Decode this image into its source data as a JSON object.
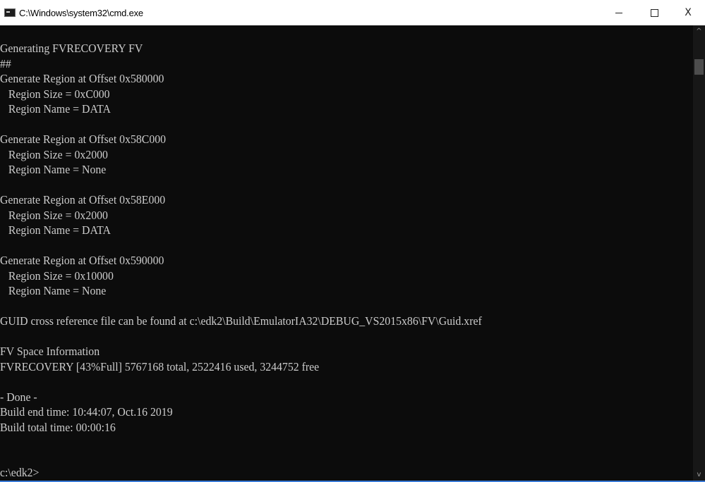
{
  "window": {
    "title": "C:\\Windows\\system32\\cmd.exe",
    "icon": "cmd-console-icon",
    "controls": {
      "minimize_glyph": "minimize-icon",
      "maximize_glyph": "maximize-icon",
      "close_label": "X"
    }
  },
  "console": {
    "text_color": "#cccccc",
    "background_color": "#0c0c0c",
    "lines": [
      "Generating FVRECOVERY FV",
      "##",
      "Generate Region at Offset 0x580000",
      "   Region Size = 0xC000",
      "   Region Name = DATA",
      "",
      "Generate Region at Offset 0x58C000",
      "   Region Size = 0x2000",
      "   Region Name = None",
      "",
      "Generate Region at Offset 0x58E000",
      "   Region Size = 0x2000",
      "   Region Name = DATA",
      "",
      "Generate Region at Offset 0x590000",
      "   Region Size = 0x10000",
      "   Region Name = None",
      "",
      "GUID cross reference file can be found at c:\\edk2\\Build\\EmulatorIA32\\DEBUG_VS2015x86\\FV\\Guid.xref",
      "",
      "FV Space Information",
      "FVRECOVERY [43%Full] 5767168 total, 2522416 used, 3244752 free",
      "",
      "- Done -",
      "Build end time: 10:44:07, Oct.16 2019",
      "Build total time: 00:00:16",
      "",
      "",
      "c:\\edk2>"
    ]
  },
  "scrollbar": {
    "up_glyph": "^",
    "down_glyph": "v"
  }
}
